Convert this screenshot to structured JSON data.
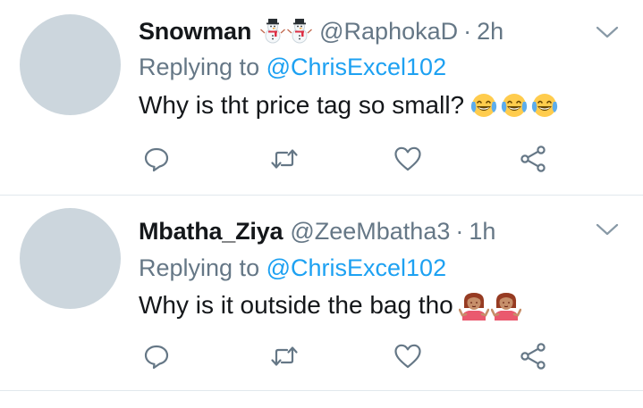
{
  "tweets": [
    {
      "name": "Snowman",
      "name_emoji": [
        "snowman-emoji",
        "snowman-emoji"
      ],
      "handle": "@RaphokaD",
      "separator": "·",
      "time": "2h",
      "replying_prefix": "Replying to ",
      "replying_to": "@ChrisExcel102",
      "text": "Why is tht price tag so small?",
      "text_emoji": [
        "tears-of-joy-emoji",
        "tears-of-joy-emoji",
        "tears-of-joy-emoji"
      ]
    },
    {
      "name": "Mbatha_Ziya",
      "handle": "@ZeeMbatha3",
      "separator": "·",
      "time": "1h",
      "replying_prefix": "Replying to ",
      "replying_to": "@ChrisExcel102",
      "text": "Why is it outside the bag tho",
      "text_emoji": [
        "person-shrugging-emoji",
        "person-shrugging-emoji"
      ]
    }
  ],
  "icons": {
    "reply": "reply-icon",
    "retweet": "retweet-icon",
    "like": "heart-icon",
    "share": "share-icon",
    "menu": "chevron-down-icon"
  },
  "colors": {
    "text": "#14171a",
    "secondary": "#657786",
    "link": "#1da1f2",
    "avatar": "#ccd6dd",
    "divider": "#e1e8ed",
    "icon": "#657786"
  }
}
